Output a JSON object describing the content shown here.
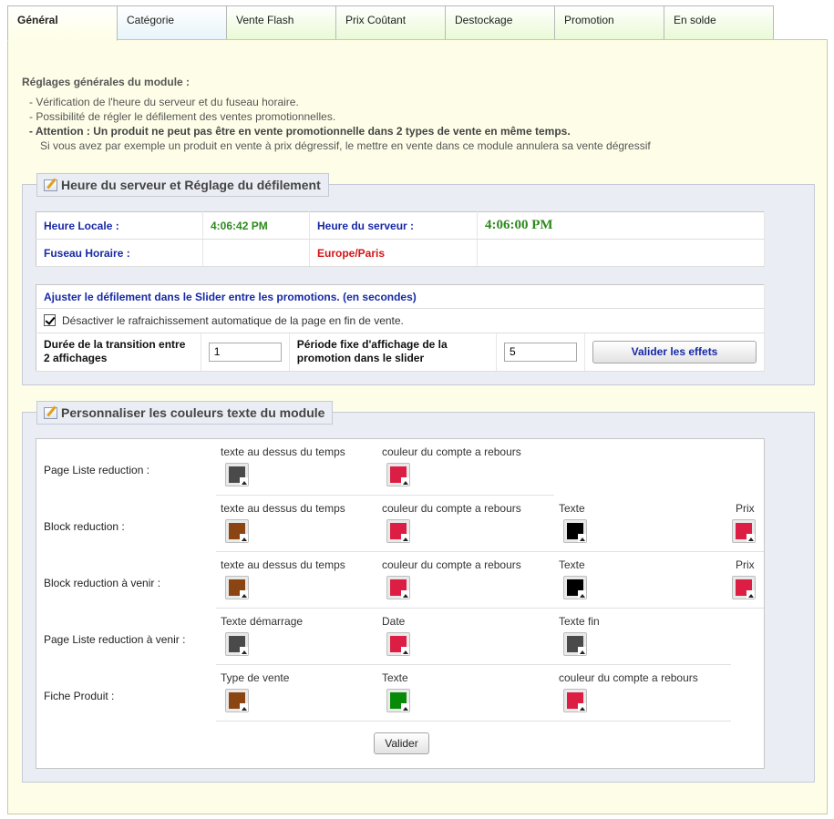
{
  "tabs": [
    {
      "label": "Général"
    },
    {
      "label": "Catégorie"
    },
    {
      "label": "Vente Flash"
    },
    {
      "label": "Prix Coûtant"
    },
    {
      "label": "Destockage"
    },
    {
      "label": "Promotion"
    },
    {
      "label": "En solde"
    }
  ],
  "intro": {
    "title": "Réglages générales du module :",
    "line1": "- Vérification de l'heure du serveur et du fuseau horaire.",
    "line2": "- Possibilité de régler le défilement des ventes promotionnelles.",
    "warning": "- Attention : Un produit ne peut pas être en vente promotionnelle dans 2 types de vente en même temps.",
    "warning_detail": "Si vous avez par exemple un produit en vente à prix dégressif, le mettre en vente dans ce module annulera sa vente dégressif"
  },
  "server": {
    "legend": "Heure du serveur et Réglage du défilement",
    "local_label": "Heure Locale :",
    "local_value": "4:06:42 PM",
    "server_label": "Heure du serveur :",
    "server_value": "4:06:00 PM",
    "tz_label": "Fuseau Horaire :",
    "tz_value": "Europe/Paris",
    "slider_title": "Ajuster le défilement dans le Slider entre les promotions. (en secondes)",
    "refresh_label": "Désactiver le rafraichissement automatique de la page en fin de vente.",
    "refresh_checked": true,
    "transition_label": "Durée de la transition entre 2 affichages",
    "transition_value": "1",
    "period_label": "Période fixe d'affichage de la promotion dans le slider",
    "period_value": "5",
    "validate_effects": "Valider les effets"
  },
  "colors": {
    "legend": "Personnaliser les couleurs texte du module",
    "rows": [
      {
        "label": "Page Liste reduction :",
        "cells": [
          {
            "label": "texte au dessus du temps",
            "color": "#4a4a4a"
          },
          {
            "label": "couleur du compte a rebours",
            "color": "#dc1e45"
          }
        ]
      },
      {
        "label": "Block reduction :",
        "cells": [
          {
            "label": "texte au dessus du temps",
            "color": "#8b4513"
          },
          {
            "label": "couleur du compte a rebours",
            "color": "#dc1e45"
          },
          {
            "label": "Texte",
            "color": "#000000"
          },
          {
            "label": "Prix",
            "color": "#dc1e45"
          }
        ]
      },
      {
        "label": "Block reduction à venir :",
        "cells": [
          {
            "label": "texte au dessus du temps",
            "color": "#8b4513"
          },
          {
            "label": "couleur du compte a rebours",
            "color": "#dc1e45"
          },
          {
            "label": "Texte",
            "color": "#000000"
          },
          {
            "label": "Prix",
            "color": "#dc1e45"
          }
        ]
      },
      {
        "label": "Page Liste reduction à venir :",
        "cells": [
          {
            "label": "Texte démarrage",
            "color": "#4a4a4a"
          },
          {
            "label": "Date",
            "color": "#dc1e45"
          },
          {
            "label": "Texte fin",
            "color": "#4a4a4a"
          }
        ]
      },
      {
        "label": "Fiche Produit :",
        "cells": [
          {
            "label": "Type de vente",
            "color": "#8b4513"
          },
          {
            "label": "Texte",
            "color": "#078a07"
          },
          {
            "label": "couleur du compte a rebours",
            "color": "#dc1e45"
          }
        ]
      }
    ],
    "validate": "Valider"
  }
}
